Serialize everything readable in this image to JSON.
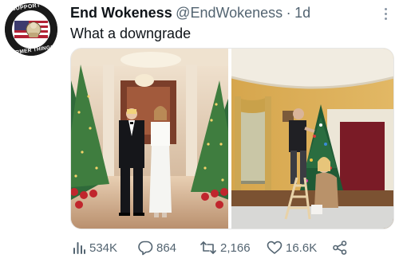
{
  "author": {
    "display_name": "End Wokeness",
    "handle": "@EndWokeness",
    "separator": "·",
    "time": "1d",
    "avatar_text_top": "I SUPPORT THE",
    "avatar_text_bottom": "FORMER THINGS"
  },
  "tweet": {
    "text": "What a downgrade"
  },
  "media": {
    "count": 2
  },
  "stats": {
    "views": "534K",
    "replies": "864",
    "retweets": "2,166",
    "likes": "16.6K"
  },
  "icons": {
    "views": "analytics-icon",
    "reply": "reply-icon",
    "retweet": "retweet-icon",
    "like": "heart-icon",
    "share": "share-icon",
    "more": "more-icon"
  },
  "colors": {
    "text_primary": "#0f1419",
    "text_secondary": "#536471"
  }
}
